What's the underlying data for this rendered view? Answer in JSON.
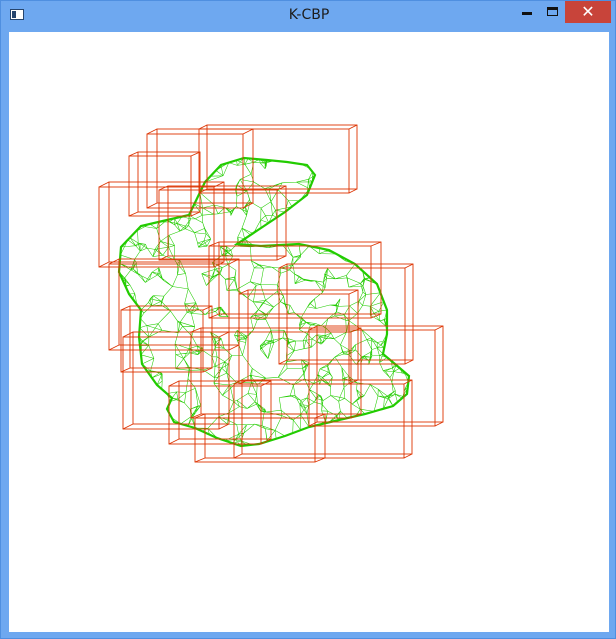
{
  "window": {
    "title": "K-CBP",
    "controls": {
      "minimize_icon": "minimize-icon",
      "maximize_icon": "maximize-icon",
      "close_glyph": "✕"
    },
    "colors": {
      "frame": "#6ea8f0",
      "close": "#c8443a",
      "canvas": "#ffffff"
    }
  },
  "scene": {
    "model": "bunny-mesh-wireframe",
    "mesh_color": "#22cc00",
    "bounding_box_color": "#dd3300"
  }
}
